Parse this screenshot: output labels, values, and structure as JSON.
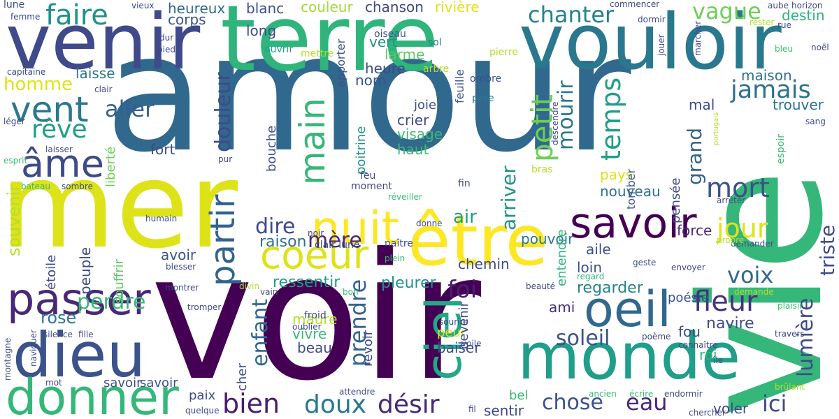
{
  "words": [
    {
      "text": "amour",
      "color": "#31688e"
    },
    {
      "text": "voir",
      "color": "#440154"
    },
    {
      "text": "vie",
      "color": "#35b779"
    },
    {
      "text": "mer",
      "color": "#dde318"
    },
    {
      "text": "terre",
      "color": "#2fb47c"
    },
    {
      "text": "vouloir",
      "color": "#2a788e"
    },
    {
      "text": "venir",
      "color": "#3e4a89"
    },
    {
      "text": "être",
      "color": "#fde725"
    },
    {
      "text": "monde",
      "color": "#1f9e89"
    },
    {
      "text": "dieu",
      "color": "#3b528b"
    },
    {
      "text": "donner",
      "color": "#35b779"
    },
    {
      "text": "passer",
      "color": "#482878"
    },
    {
      "text": "oeil",
      "color": "#31688e"
    },
    {
      "text": "savoir",
      "color": "#440154"
    },
    {
      "text": "nuit",
      "color": "#fde725"
    },
    {
      "text": "coeur",
      "color": "#dde318"
    },
    {
      "text": "ciel",
      "color": "#22a884"
    },
    {
      "text": "vent",
      "color": "#2a788e"
    },
    {
      "text": "âme",
      "color": "#3e4a89"
    },
    {
      "text": "faire",
      "color": "#21918c"
    },
    {
      "text": "main",
      "color": "#35b779"
    },
    {
      "text": "partir",
      "color": "#33638d"
    },
    {
      "text": "jamais",
      "color": "#2c728e"
    },
    {
      "text": "temps",
      "color": "#1f9e89"
    },
    {
      "text": "chanter",
      "color": "#26828e"
    },
    {
      "text": "petit",
      "color": "#6ece58"
    },
    {
      "text": "mourir",
      "color": "#2a788e"
    },
    {
      "text": "mort",
      "color": "#3b528b"
    },
    {
      "text": "jour",
      "color": "#dde318"
    },
    {
      "text": "fleur",
      "color": "#46327e"
    },
    {
      "text": "soleil",
      "color": "#3b528b"
    },
    {
      "text": "lumière",
      "color": "#3e4a89"
    },
    {
      "text": "triste",
      "color": "#3e4a89"
    },
    {
      "text": "grand",
      "color": "#33638d"
    },
    {
      "text": "rêve",
      "color": "#1f9e89"
    },
    {
      "text": "homme",
      "color": "#dde318"
    },
    {
      "text": "aller",
      "color": "#35608d"
    },
    {
      "text": "souvenir",
      "color": "#b5de2b"
    },
    {
      "text": "arriver",
      "color": "#21918c"
    },
    {
      "text": "douleur",
      "color": "#3e4a89"
    },
    {
      "text": "désir",
      "color": "#482878"
    },
    {
      "text": "doux",
      "color": "#2a788e"
    },
    {
      "text": "bien",
      "color": "#481f70"
    },
    {
      "text": "chose",
      "color": "#3b528b"
    },
    {
      "text": "eau",
      "color": "#482878"
    },
    {
      "text": "ici",
      "color": "#3e4a89"
    },
    {
      "text": "foi",
      "color": "#481f70"
    },
    {
      "text": "voix",
      "color": "#31688e"
    },
    {
      "text": "prendre",
      "color": "#33638d"
    },
    {
      "text": "perdre",
      "color": "#3aba76"
    },
    {
      "text": "enfant",
      "color": "#31688e"
    },
    {
      "text": "dire",
      "color": "#3e4a89"
    },
    {
      "text": "mère",
      "color": "#482878"
    },
    {
      "text": "vague",
      "color": "#6ece58"
    },
    {
      "text": "air",
      "color": "#1f9e89"
    },
    {
      "text": "rose",
      "color": "#2a788e"
    },
    {
      "text": "pleurer",
      "color": "#21918c"
    },
    {
      "text": "regarder",
      "color": "#26828e"
    },
    {
      "text": "navire",
      "color": "#3e4a89"
    },
    {
      "text": "ressentir",
      "color": "#1f9e89"
    },
    {
      "text": "raison",
      "color": "#2c728e"
    },
    {
      "text": "fort",
      "color": "#3e4a89"
    },
    {
      "text": "fou",
      "color": "#3e4a89"
    },
    {
      "text": "laisse",
      "color": "#2a788e"
    },
    {
      "text": "heureux",
      "color": "#31688e"
    },
    {
      "text": "corps",
      "color": "#3b528b"
    },
    {
      "text": "couleur",
      "color": "#a0da39"
    },
    {
      "text": "chanson",
      "color": "#3e4a89"
    },
    {
      "text": "rivière",
      "color": "#dde318"
    },
    {
      "text": "destin",
      "color": "#2fb47c"
    },
    {
      "text": "long",
      "color": "#3e4a89"
    },
    {
      "text": "vert",
      "color": "#21918c"
    },
    {
      "text": "larme",
      "color": "#5ec962"
    },
    {
      "text": "heure",
      "color": "#3e4a89"
    },
    {
      "text": "nom",
      "color": "#3b528b"
    },
    {
      "text": "maison",
      "color": "#2c728e"
    },
    {
      "text": "trouver",
      "color": "#2c728e"
    },
    {
      "text": "crier",
      "color": "#3e4a89"
    },
    {
      "text": "joie",
      "color": "#3b528b"
    },
    {
      "text": "visage",
      "color": "#3aba76"
    },
    {
      "text": "haut",
      "color": "#3aba76"
    },
    {
      "text": "blanc",
      "color": "#3b528b"
    },
    {
      "text": "mal",
      "color": "#3e4a89"
    },
    {
      "text": "pays",
      "color": "#dde318"
    },
    {
      "text": "nouveau",
      "color": "#2c728e"
    },
    {
      "text": "pouvoir",
      "color": "#2a788e"
    },
    {
      "text": "force",
      "color": "#482878"
    },
    {
      "text": "aile",
      "color": "#3b528b"
    },
    {
      "text": "loin",
      "color": "#3b528b"
    },
    {
      "text": "chemin",
      "color": "#3e4a89"
    },
    {
      "text": "ami",
      "color": "#46327e"
    },
    {
      "text": "maure",
      "color": "#b5de2b"
    },
    {
      "text": "vivre",
      "color": "#3aba76"
    },
    {
      "text": "beau",
      "color": "#3e4a89"
    },
    {
      "text": "baiser",
      "color": "#3e4a89"
    },
    {
      "text": "peur",
      "color": "#dde318"
    },
    {
      "text": "avoir",
      "color": "#3b528b"
    },
    {
      "text": "sentir",
      "color": "#3e4a89"
    },
    {
      "text": "voler",
      "color": "#3e4a89"
    },
    {
      "text": "bel",
      "color": "#3aba76"
    },
    {
      "text": "paix",
      "color": "#3e4a89"
    },
    {
      "text": "roi",
      "color": "#2fb47c"
    },
    {
      "text": "poésie",
      "color": "#3b528b"
    },
    {
      "text": "peuple",
      "color": "#3e4a89"
    },
    {
      "text": "souffrir",
      "color": "#5ec962"
    },
    {
      "text": "étoile",
      "color": "#3e4a89"
    },
    {
      "text": "liberté",
      "color": "#6ece58"
    },
    {
      "text": "bouche",
      "color": "#3b528b"
    },
    {
      "text": "poitrine",
      "color": "#21918c"
    },
    {
      "text": "devenir",
      "color": "#3e4a89"
    },
    {
      "text": "revoir",
      "color": "#3e4a89"
    },
    {
      "text": "cher",
      "color": "#3e4a89"
    },
    {
      "text": "savoir",
      "color": "#3b528b"
    },
    {
      "text": "savoir",
      "color": "#3b528b"
    },
    {
      "text": "pensée",
      "color": "#3e4a89"
    },
    {
      "text": "entendre",
      "color": "#2fb47c"
    },
    {
      "text": "tomber",
      "color": "#3b528b"
    },
    {
      "text": "feuille",
      "color": "#3b528b"
    },
    {
      "text": "apporter",
      "color": "#3b528b"
    },
    {
      "text": "oiseau",
      "color": "#3b528b"
    },
    {
      "text": "ouvrir",
      "color": "#1f9e89"
    },
    {
      "text": "mettre",
      "color": "#b5de2b"
    },
    {
      "text": "sol",
      "color": "#2a788e"
    },
    {
      "text": "pierre",
      "color": "#b5de2b"
    },
    {
      "text": "arbre",
      "color": "#b5de2b"
    },
    {
      "text": "ombre",
      "color": "#3b528b"
    },
    {
      "text": "père",
      "color": "#2a788e"
    },
    {
      "text": "descendre",
      "color": "#3e4a89"
    },
    {
      "text": "bras",
      "color": "#b5de2b"
    },
    {
      "text": "feu",
      "color": "#3e4a89"
    },
    {
      "text": "moment",
      "color": "#3e4a89"
    },
    {
      "text": "fin",
      "color": "#3e4a89"
    },
    {
      "text": "réveiller",
      "color": "#3aba76"
    },
    {
      "text": "donne",
      "color": "#3e4a89"
    },
    {
      "text": "naître",
      "color": "#3e4a89"
    },
    {
      "text": "clair lune",
      "color": "#3e4a89"
    },
    {
      "text": "plein",
      "color": "#3aba76"
    },
    {
      "text": "vain",
      "color": "#3e4a89"
    },
    {
      "text": "bon",
      "color": "#3aba76"
    },
    {
      "text": "froid",
      "color": "#3e4a89"
    },
    {
      "text": "oublier",
      "color": "#3e4a89"
    },
    {
      "text": "sourire",
      "color": "#3e4a89"
    },
    {
      "text": "voile",
      "color": "#3e4a89"
    },
    {
      "text": "beauté",
      "color": "#3e4a89"
    },
    {
      "text": "regard",
      "color": "#3aba76"
    },
    {
      "text": "geste",
      "color": "#3e4a89"
    },
    {
      "text": "envoyer",
      "color": "#3e4a89"
    },
    {
      "text": "demander",
      "color": "#3e4a89"
    },
    {
      "text": "arrêter",
      "color": "#3e4a89"
    },
    {
      "text": "propre",
      "color": "#b5de2b"
    },
    {
      "text": "plaisir",
      "color": "#3aba76"
    },
    {
      "text": "demande",
      "color": "#b5de2b"
    },
    {
      "text": "poème",
      "color": "#3e4a89"
    },
    {
      "text": "connaître",
      "color": "#3e4a89"
    },
    {
      "text": "travers",
      "color": "#3e4a89"
    },
    {
      "text": "île",
      "color": "#3b528b"
    },
    {
      "text": "endormir",
      "color": "#3e4a89"
    },
    {
      "text": "ancien",
      "color": "#3aba76"
    },
    {
      "text": "écrire",
      "color": "#3aba76"
    },
    {
      "text": "chercher",
      "color": "#3e4a89"
    },
    {
      "text": "brûlant",
      "color": "#b5de2b"
    },
    {
      "text": "fil",
      "color": "#3e4a89"
    },
    {
      "text": "attendre",
      "color": "#3e4a89"
    },
    {
      "text": "quelque",
      "color": "#3e4a89"
    },
    {
      "text": "mot",
      "color": "#3e4a89"
    },
    {
      "text": "tromper",
      "color": "#3e4a89"
    },
    {
      "text": "montrer",
      "color": "#3e4a89"
    },
    {
      "text": "divin",
      "color": "#b5de2b"
    },
    {
      "text": "blesser",
      "color": "#3e4a89"
    },
    {
      "text": "humain",
      "color": "#3e4a89"
    },
    {
      "text": "noir",
      "color": "#3e4a89"
    },
    {
      "text": "pur",
      "color": "#3e4a89"
    },
    {
      "text": "silence",
      "color": "#3e4a89"
    },
    {
      "text": "fille",
      "color": "#3e4a89"
    },
    {
      "text": "montagne",
      "color": "#3e4a89"
    },
    {
      "text": "naviguer",
      "color": "#3e4a89"
    },
    {
      "text": "sombre",
      "color": "#3e4a89"
    },
    {
      "text": "bateau",
      "color": "#3aba76"
    },
    {
      "text": "esprit",
      "color": "#3aba76"
    },
    {
      "text": "laisser",
      "color": "#3e4a89"
    },
    {
      "text": "léger",
      "color": "#3e4a89"
    },
    {
      "text": "clair",
      "color": "#3e4a89"
    },
    {
      "text": "capitaine",
      "color": "#3e4a89"
    },
    {
      "text": "pied",
      "color": "#3e4a89"
    },
    {
      "text": "dur",
      "color": "#3e4a89"
    },
    {
      "text": "lune",
      "color": "#3e4a89"
    },
    {
      "text": "femme",
      "color": "#3e4a89"
    },
    {
      "text": "vieux",
      "color": "#3e4a89"
    },
    {
      "text": "commencer",
      "color": "#3e4a89"
    },
    {
      "text": "dormir",
      "color": "#3e4a89"
    },
    {
      "text": "jouer",
      "color": "#3e4a89"
    },
    {
      "text": "marcher",
      "color": "#3e4a89"
    },
    {
      "text": "aube",
      "color": "#3e4a89"
    },
    {
      "text": "horizon",
      "color": "#3e4a89"
    },
    {
      "text": "rester",
      "color": "#b5de2b"
    },
    {
      "text": "rue",
      "color": "#3e4a89"
    },
    {
      "text": "bleu",
      "color": "#3aba76"
    },
    {
      "text": "noël",
      "color": "#3e4a89"
    },
    {
      "text": "espoir",
      "color": "#3aba76"
    },
    {
      "text": "sang",
      "color": "#3e4a89"
    },
    {
      "text": "portugais",
      "color": "#b5de2b"
    }
  ]
}
